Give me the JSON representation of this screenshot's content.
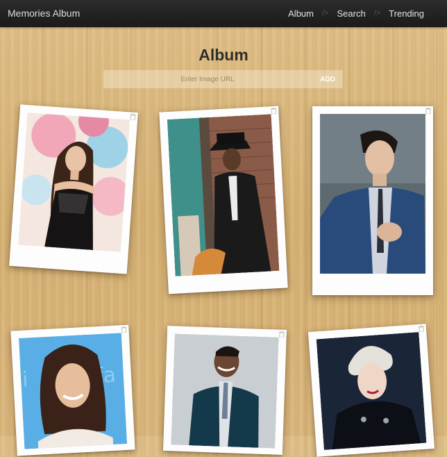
{
  "app": {
    "brand": "Memories Album"
  },
  "nav": {
    "items": [
      "Album",
      "Search",
      "Trending"
    ],
    "separator": "/>"
  },
  "page": {
    "title": "Album"
  },
  "url_form": {
    "placeholder": "Enter Image URL",
    "value": "",
    "add_label": "ADD"
  },
  "colors": {
    "navbar": "#1f1f1f",
    "wood": "#d9b77c",
    "polaroid": "#fdfdfd"
  },
  "photos": [
    {
      "id": "photo-1",
      "icon": "trash-icon"
    },
    {
      "id": "photo-2",
      "icon": "trash-icon"
    },
    {
      "id": "photo-3",
      "icon": "trash-icon"
    },
    {
      "id": "photo-4",
      "icon": "trash-icon"
    },
    {
      "id": "photo-5",
      "icon": "trash-icon"
    },
    {
      "id": "photo-6",
      "icon": "trash-icon"
    }
  ]
}
